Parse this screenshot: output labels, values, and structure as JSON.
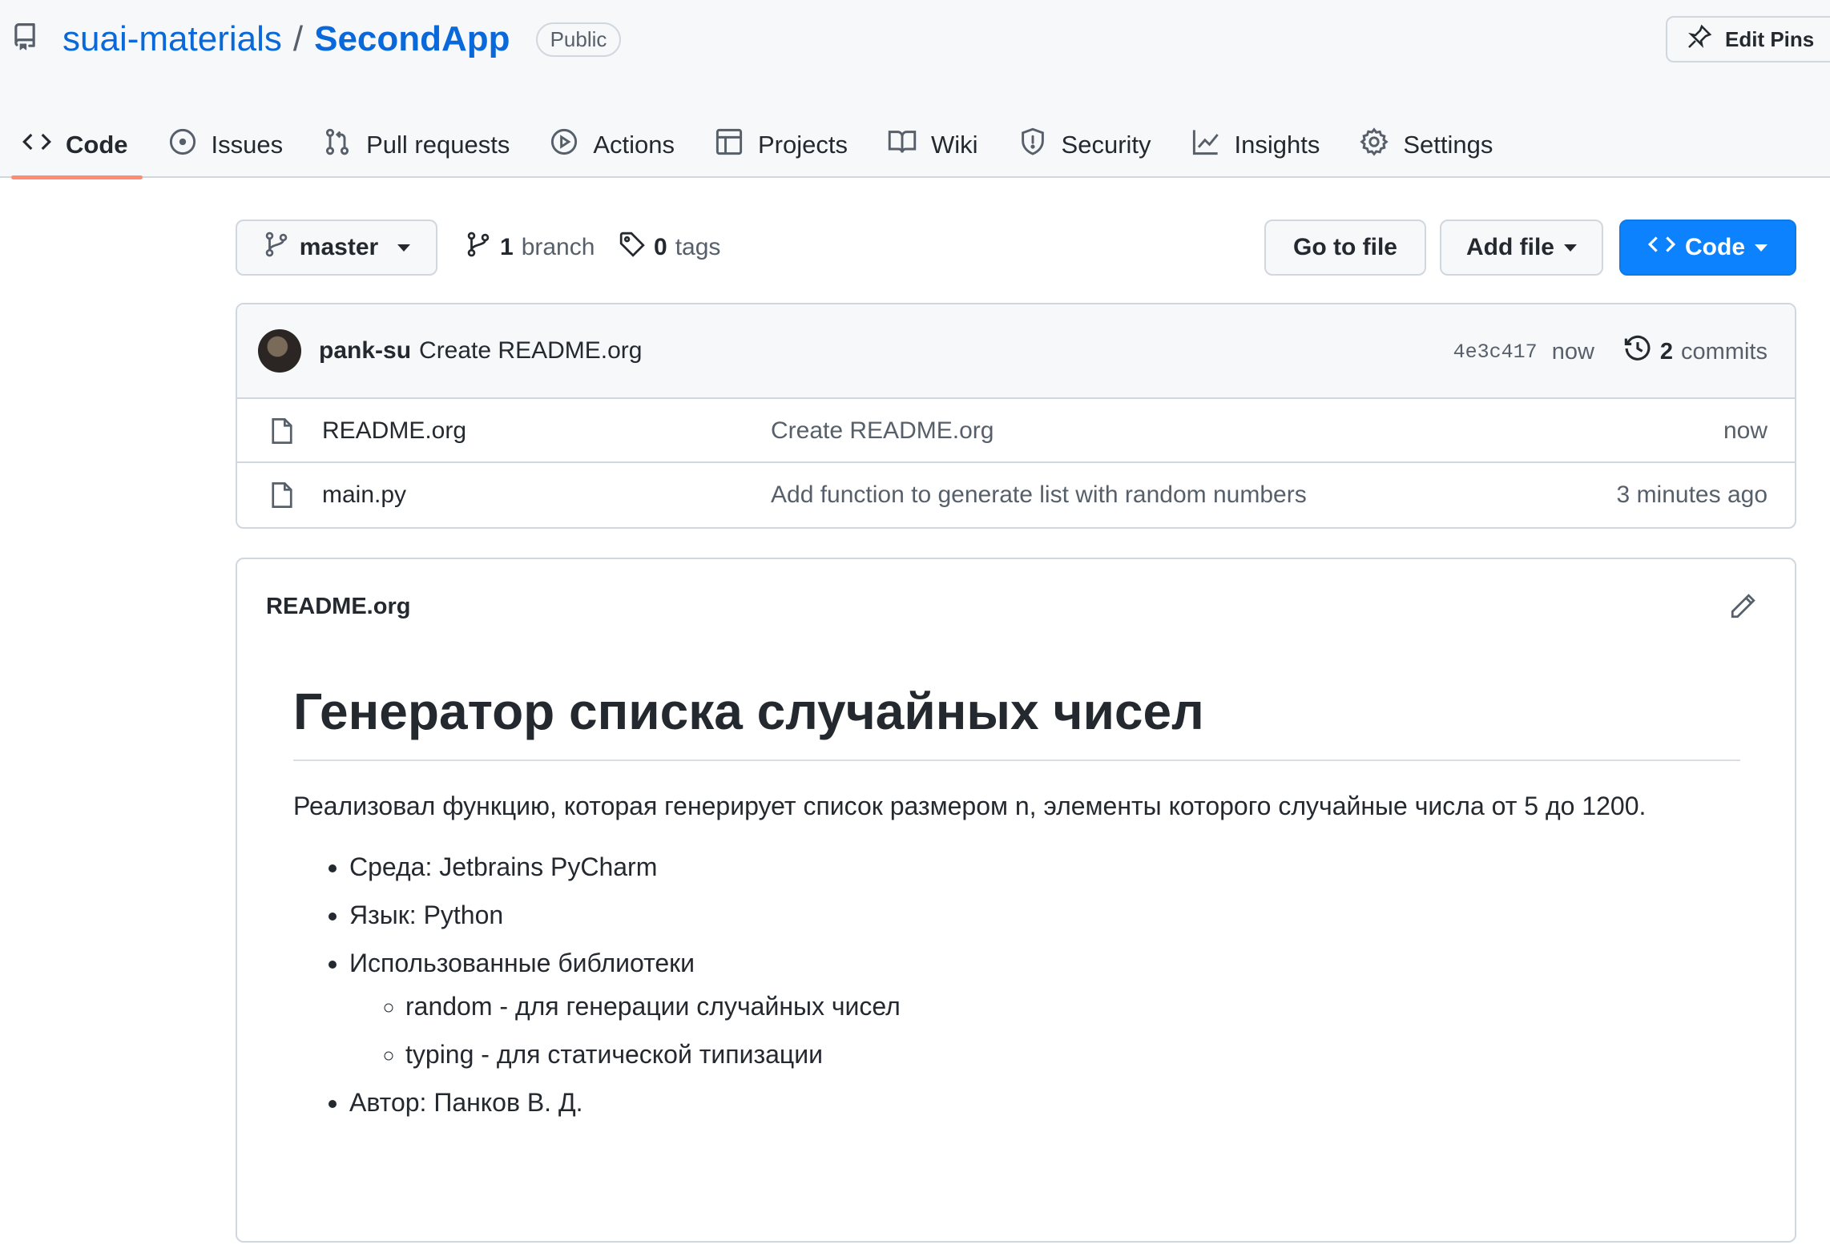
{
  "header": {
    "owner": "suai-materials",
    "separator": "/",
    "repo": "SecondApp",
    "visibility": "Public",
    "edit_pins": "Edit Pins"
  },
  "tabs": [
    {
      "label": "Code",
      "icon": "code-icon",
      "active": true
    },
    {
      "label": "Issues",
      "icon": "issue-icon"
    },
    {
      "label": "Pull requests",
      "icon": "pull-request-icon"
    },
    {
      "label": "Actions",
      "icon": "play-icon"
    },
    {
      "label": "Projects",
      "icon": "table-icon"
    },
    {
      "label": "Wiki",
      "icon": "book-icon"
    },
    {
      "label": "Security",
      "icon": "shield-icon"
    },
    {
      "label": "Insights",
      "icon": "graph-icon"
    },
    {
      "label": "Settings",
      "icon": "gear-icon"
    }
  ],
  "toolbar": {
    "branch": "master",
    "branch_count": "1",
    "branch_label": "branch",
    "tag_count": "0",
    "tag_label": "tags",
    "go_to_file": "Go to file",
    "add_file": "Add file",
    "code": "Code"
  },
  "commit": {
    "author": "pank-su",
    "message": "Create README.org",
    "sha": "4e3c417",
    "time": "now",
    "commit_count": "2",
    "commit_label": "commits"
  },
  "files": [
    {
      "name": "README.org",
      "message": "Create README.org",
      "age": "now"
    },
    {
      "name": "main.py",
      "message": "Add function to generate list with random numbers",
      "age": "3 minutes ago"
    }
  ],
  "readme": {
    "filename": "README.org",
    "heading": "Генератор списка случайных чисел",
    "paragraph": "Реализовал функцию, которая генерирует список размером n, элементы которого случайные числа от 5 до 1200.",
    "items": [
      "Среда: Jetbrains PyCharm",
      "Язык: Python",
      "Использованные библиотеки"
    ],
    "subitems": [
      "random - для генерации случайных чисел",
      "typing - для статической типизации"
    ],
    "last_item": "Автор: Панков В. Д."
  },
  "colors": {
    "link": "#0969da",
    "active_tab_underline": "#fd8c73",
    "code_button": "#0d82ff",
    "border": "#d0d7de"
  }
}
